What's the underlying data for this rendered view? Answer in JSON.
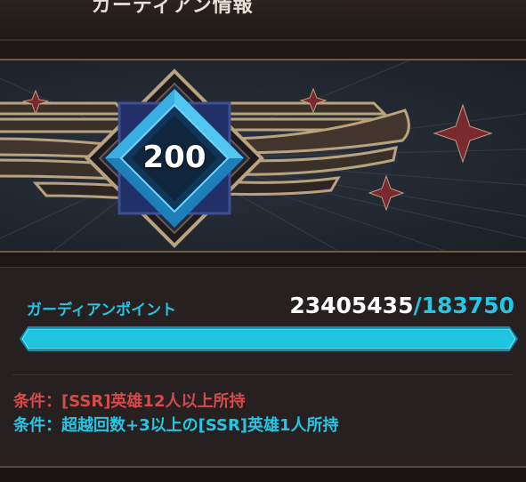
{
  "header": {
    "title": "ガーディアン情報"
  },
  "emblem": {
    "level": "200"
  },
  "points": {
    "label": "ガーディアンポイント",
    "current": "23405435",
    "separator": "/",
    "max": "183750",
    "progress_fraction": 1.0
  },
  "conditions": [
    {
      "text": "条件：[SSR]英雄12人以上所持",
      "color": "#d64a4a"
    },
    {
      "text": "条件：超越回数+3以上の[SSR]英雄1人所持",
      "color": "#27c5e4"
    }
  ],
  "colors": {
    "accent": "#27c5e4",
    "warning": "#d64a4a",
    "gold": "#b9a27e",
    "background": "#1d1815"
  },
  "icons": {
    "emblem": "winged-diamond-emblem",
    "stars": "four-point-star-icon"
  }
}
